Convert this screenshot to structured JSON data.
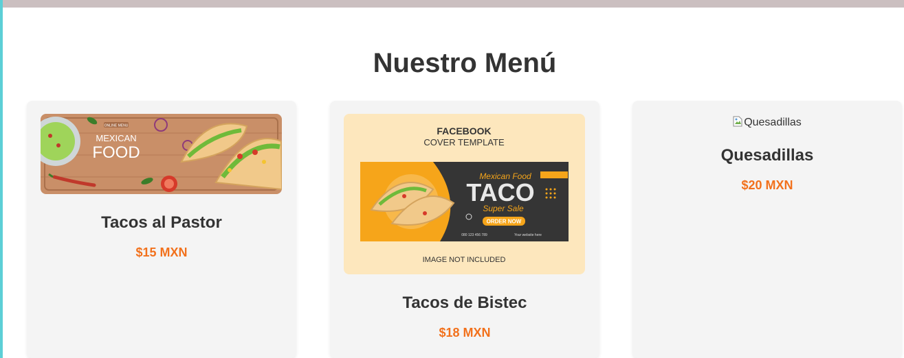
{
  "page": {
    "title": "Nuestro Menú"
  },
  "items": [
    {
      "name": "Tacos al Pastor",
      "price": "$15 MXN",
      "image": {
        "kind": "banner",
        "badge": "ONLINE MENU",
        "headline_1": "MEXICAN",
        "headline_2": "FOOD"
      }
    },
    {
      "name": "Tacos de Bistec",
      "price": "$18 MXN",
      "image": {
        "kind": "template",
        "heading": "FACEBOOK",
        "subheading": "COVER TEMPLATE",
        "script_text": "Mexican Food",
        "big_text": "TACO",
        "sale_text": "Super Sale",
        "button_text": "ORDER NOW",
        "phone": "080 123 456 789",
        "website": "Your website here",
        "footer": "IMAGE NOT INCLUDED"
      }
    },
    {
      "name": "Quesadillas",
      "price": "$20 MXN",
      "image": {
        "kind": "broken",
        "alt": "Quesadillas"
      }
    }
  ],
  "colors": {
    "price": "#f2711c",
    "card_bg": "#f4f4f4",
    "accent_left": "#5ccfd6",
    "top_strip": "#cbbfc0",
    "promo_orange": "#f6a51a"
  }
}
